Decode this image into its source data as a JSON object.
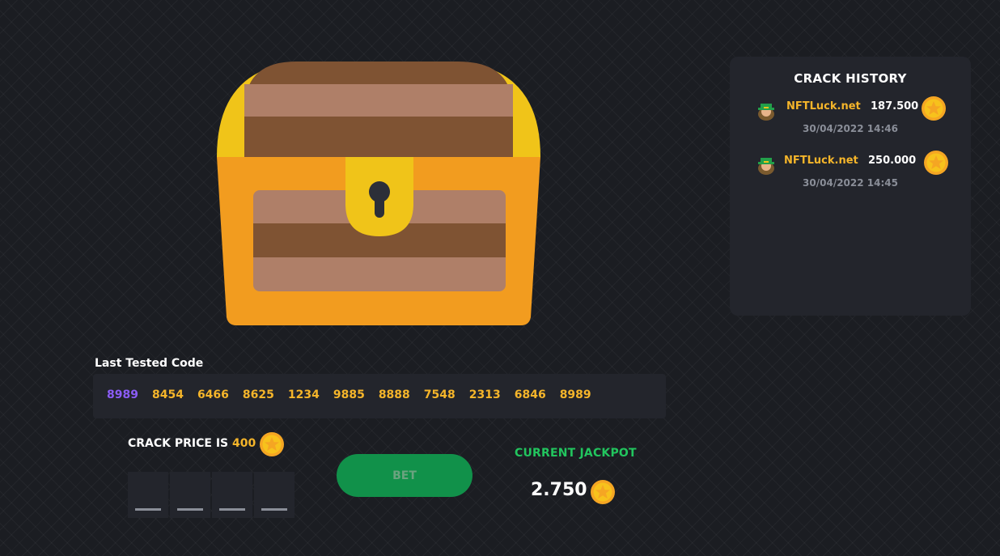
{
  "history": {
    "title": "CRACK HISTORY",
    "entries": [
      {
        "name": "NFTLuck.net",
        "amount": "187.500",
        "date": "30/04/2022 14:46",
        "avatar_icon": "leprechaun-avatar-icon",
        "coin_icon": "gold-star-coin-icon"
      },
      {
        "name": "NFTLuck.net",
        "amount": "250.000",
        "date": "30/04/2022 14:45",
        "avatar_icon": "leprechaun-avatar-icon",
        "coin_icon": "gold-star-coin-icon"
      }
    ]
  },
  "last_tested": {
    "label": "Last Tested Code",
    "codes": [
      "8989",
      "8454",
      "6466",
      "8625",
      "1234",
      "9885",
      "8888",
      "7548",
      "2313",
      "6846",
      "8989"
    ]
  },
  "crack": {
    "label_prefix": "CRACK PRICE IS ",
    "price": "400",
    "coin_icon": "gold-star-coin-icon",
    "digit_count": 4
  },
  "bet_button": {
    "label": "BET"
  },
  "jackpot": {
    "label": "CURRENT JACKPOT",
    "value": "2.750",
    "coin_icon": "gold-star-coin-icon"
  },
  "colors": {
    "background": "#1b1d22",
    "panel": "#23252c",
    "gold": "#f5b52a",
    "purple": "#8b5cf6",
    "green": "#22c55e",
    "button_green": "#11914a"
  }
}
